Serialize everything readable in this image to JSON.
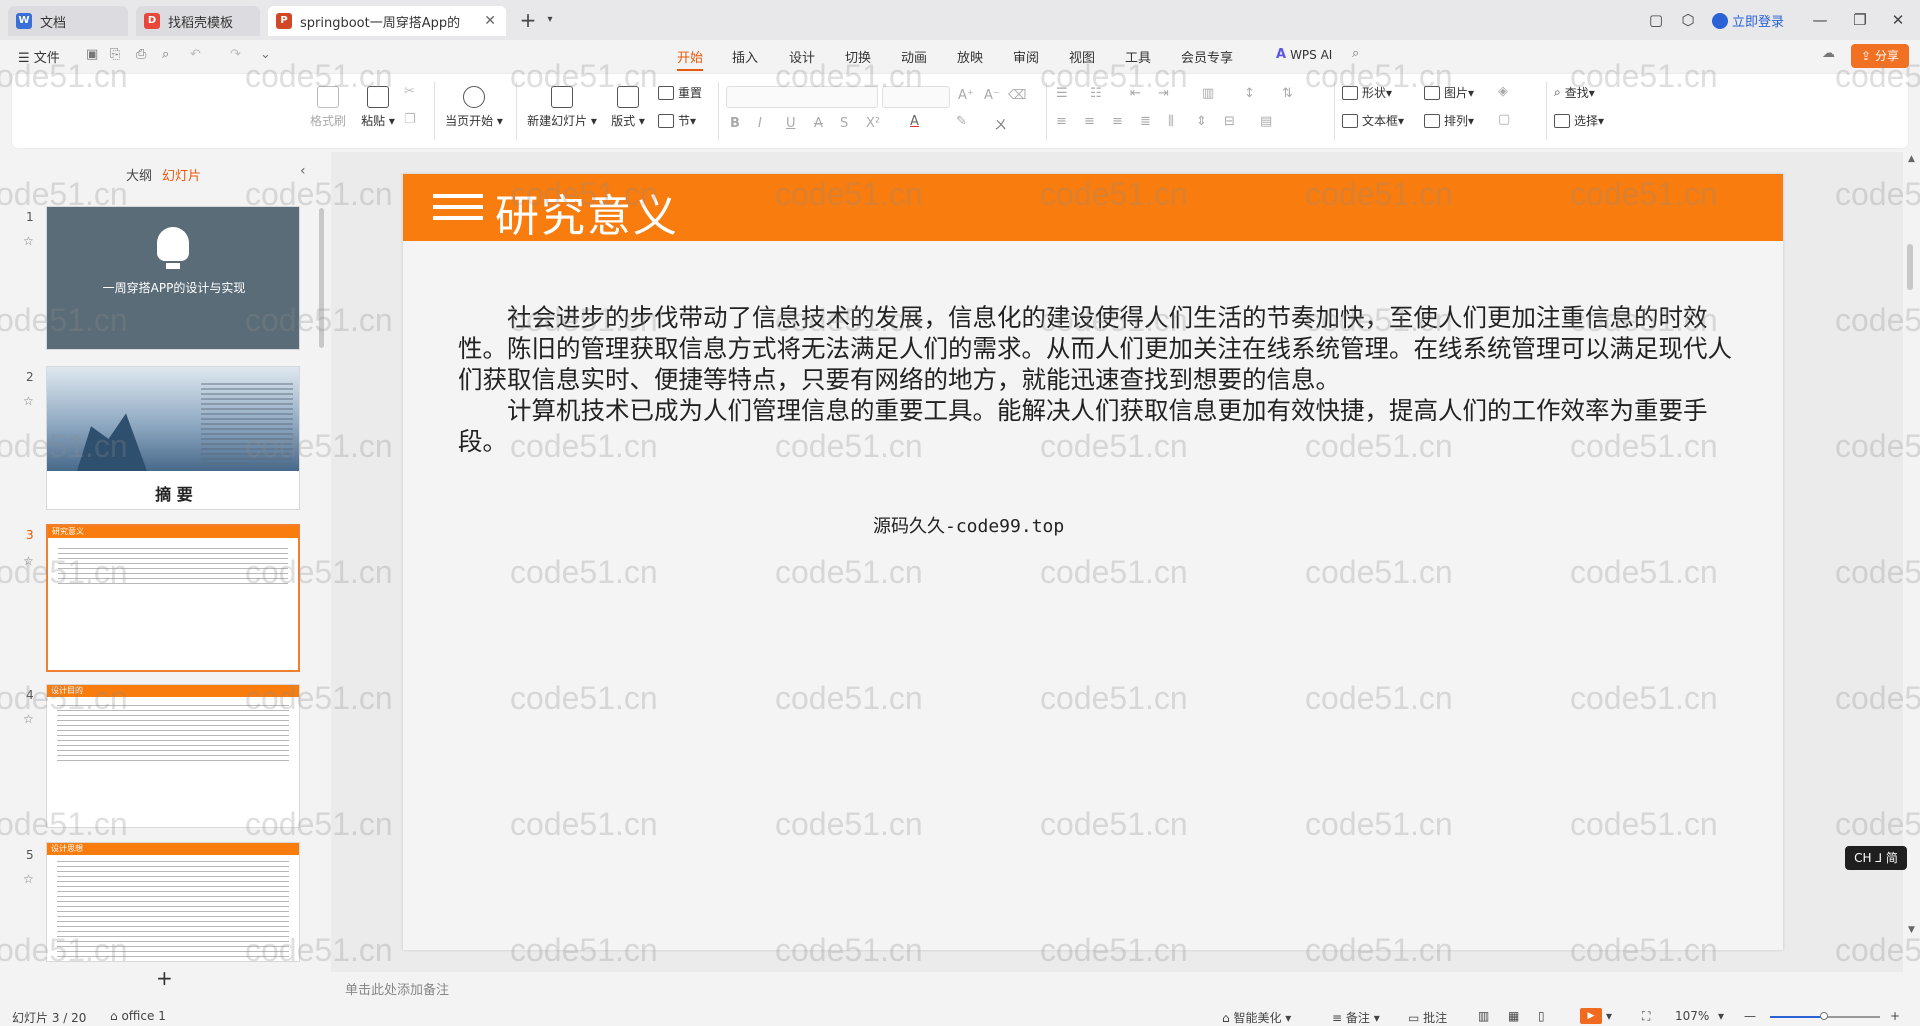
{
  "tabs": [
    {
      "label": "文档",
      "icon": "docs-icon",
      "color": "#3b6fd8"
    },
    {
      "label": "找稻壳模板",
      "icon": "docer-icon",
      "color": "#e8473b"
    },
    {
      "label": "springboot一周穿搭App的",
      "icon": "ppt-icon",
      "color": "#d24726"
    }
  ],
  "titlebar": {
    "login_label": "立即登录",
    "new_tab": "+"
  },
  "menubar": {
    "file_label": "文件",
    "menus": [
      "开始",
      "插入",
      "设计",
      "切换",
      "动画",
      "放映",
      "审阅",
      "视图",
      "工具",
      "会员专享"
    ],
    "active_menu": "开始",
    "wps_ai_label": "WPS AI",
    "share_label": "分享"
  },
  "ribbon": {
    "format_painter": "格式刷",
    "paste": "粘贴",
    "play_from_current": "当页开始",
    "new_slide": "新建幻灯片",
    "layout": "版式",
    "reset": "重置",
    "section": "节",
    "shape": "形状",
    "picture": "图片",
    "find": "查找",
    "textbox": "文本框",
    "arrange": "排列",
    "select": "选择"
  },
  "sidebar": {
    "tab_outline": "大纲",
    "tab_slides": "幻灯片",
    "slides": [
      {
        "num": "1",
        "title": "一周穿搭APP的设计与实现"
      },
      {
        "num": "2",
        "title": "摘 要"
      },
      {
        "num": "3",
        "title": "研究意义"
      },
      {
        "num": "4",
        "title": "设计目的"
      },
      {
        "num": "5",
        "title": "设计思想"
      }
    ],
    "add_label": "+"
  },
  "slide": {
    "title": "研究意义",
    "para1": "社会进步的步伐带动了信息技术的发展，信息化的建设使得人们生活的节奏加快，至使人们更加注重信息的时效性。陈旧的管理获取信息方式将无法满足人们的需求。从而人们更加关注在线系统管理。在线系统管理可以满足现代人们获取信息实时、便捷等特点，只要有网络的地方，就能迅速查找到想要的信息。",
    "para2": "计算机技术已成为人们管理信息的重要工具。能解决人们获取信息更加有效快捷，提高人们的工作效率为重要手段。",
    "source_text": "源码久久-code99.top"
  },
  "watermark": "code51.cn",
  "ime_badge": "CH ⅃ 简",
  "notes_placeholder": "单击此处添加备注",
  "status": {
    "slide_counter": "幻灯片 3 / 20",
    "theme": "office 1",
    "beautify": "智能美化",
    "notes": "备注",
    "comments": "批注",
    "zoom": "107%"
  },
  "colors": {
    "accent": "#e8590c",
    "slide_header": "#f97c0f",
    "selected_border": "#f08030"
  }
}
